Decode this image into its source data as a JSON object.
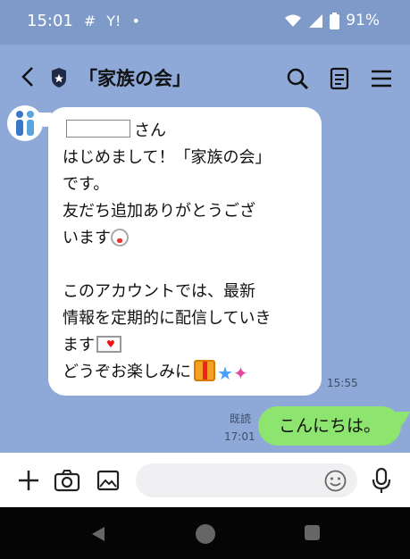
{
  "status_bar": {
    "time": "15:01",
    "slack_glyph": "#",
    "yahoo_glyph": "Y!",
    "dot": "•",
    "battery": "91%",
    "wifi": "wifi-icon",
    "signal": "signal-icon"
  },
  "header": {
    "title": "「家族の会」"
  },
  "messages": {
    "incoming": {
      "greeting_suffix": "さん",
      "line1": "はじめまして！「家族の会」",
      "line2": "です。",
      "line3": "友だち追加ありがとうござ",
      "line4": "います",
      "line5": "このアカウントでは、最新",
      "line6": "情報を定期的に配信していき",
      "line7": "ます",
      "line8": "どうぞお楽しみに",
      "time": "15:55"
    },
    "outgoing": {
      "text": "こんにちは。",
      "read_label": "既読",
      "time": "17:01"
    }
  },
  "input": {
    "placeholder": ""
  },
  "icons": [
    "back-icon",
    "shield-icon",
    "search-icon",
    "note-icon",
    "menu-icon",
    "plus-icon",
    "camera-icon",
    "image-icon",
    "smile-icon",
    "mic-icon"
  ],
  "colors": {
    "chat_bg": "#8ea8d8",
    "outgoing_bubble": "#8de46f",
    "incoming_bubble": "#ffffff"
  }
}
